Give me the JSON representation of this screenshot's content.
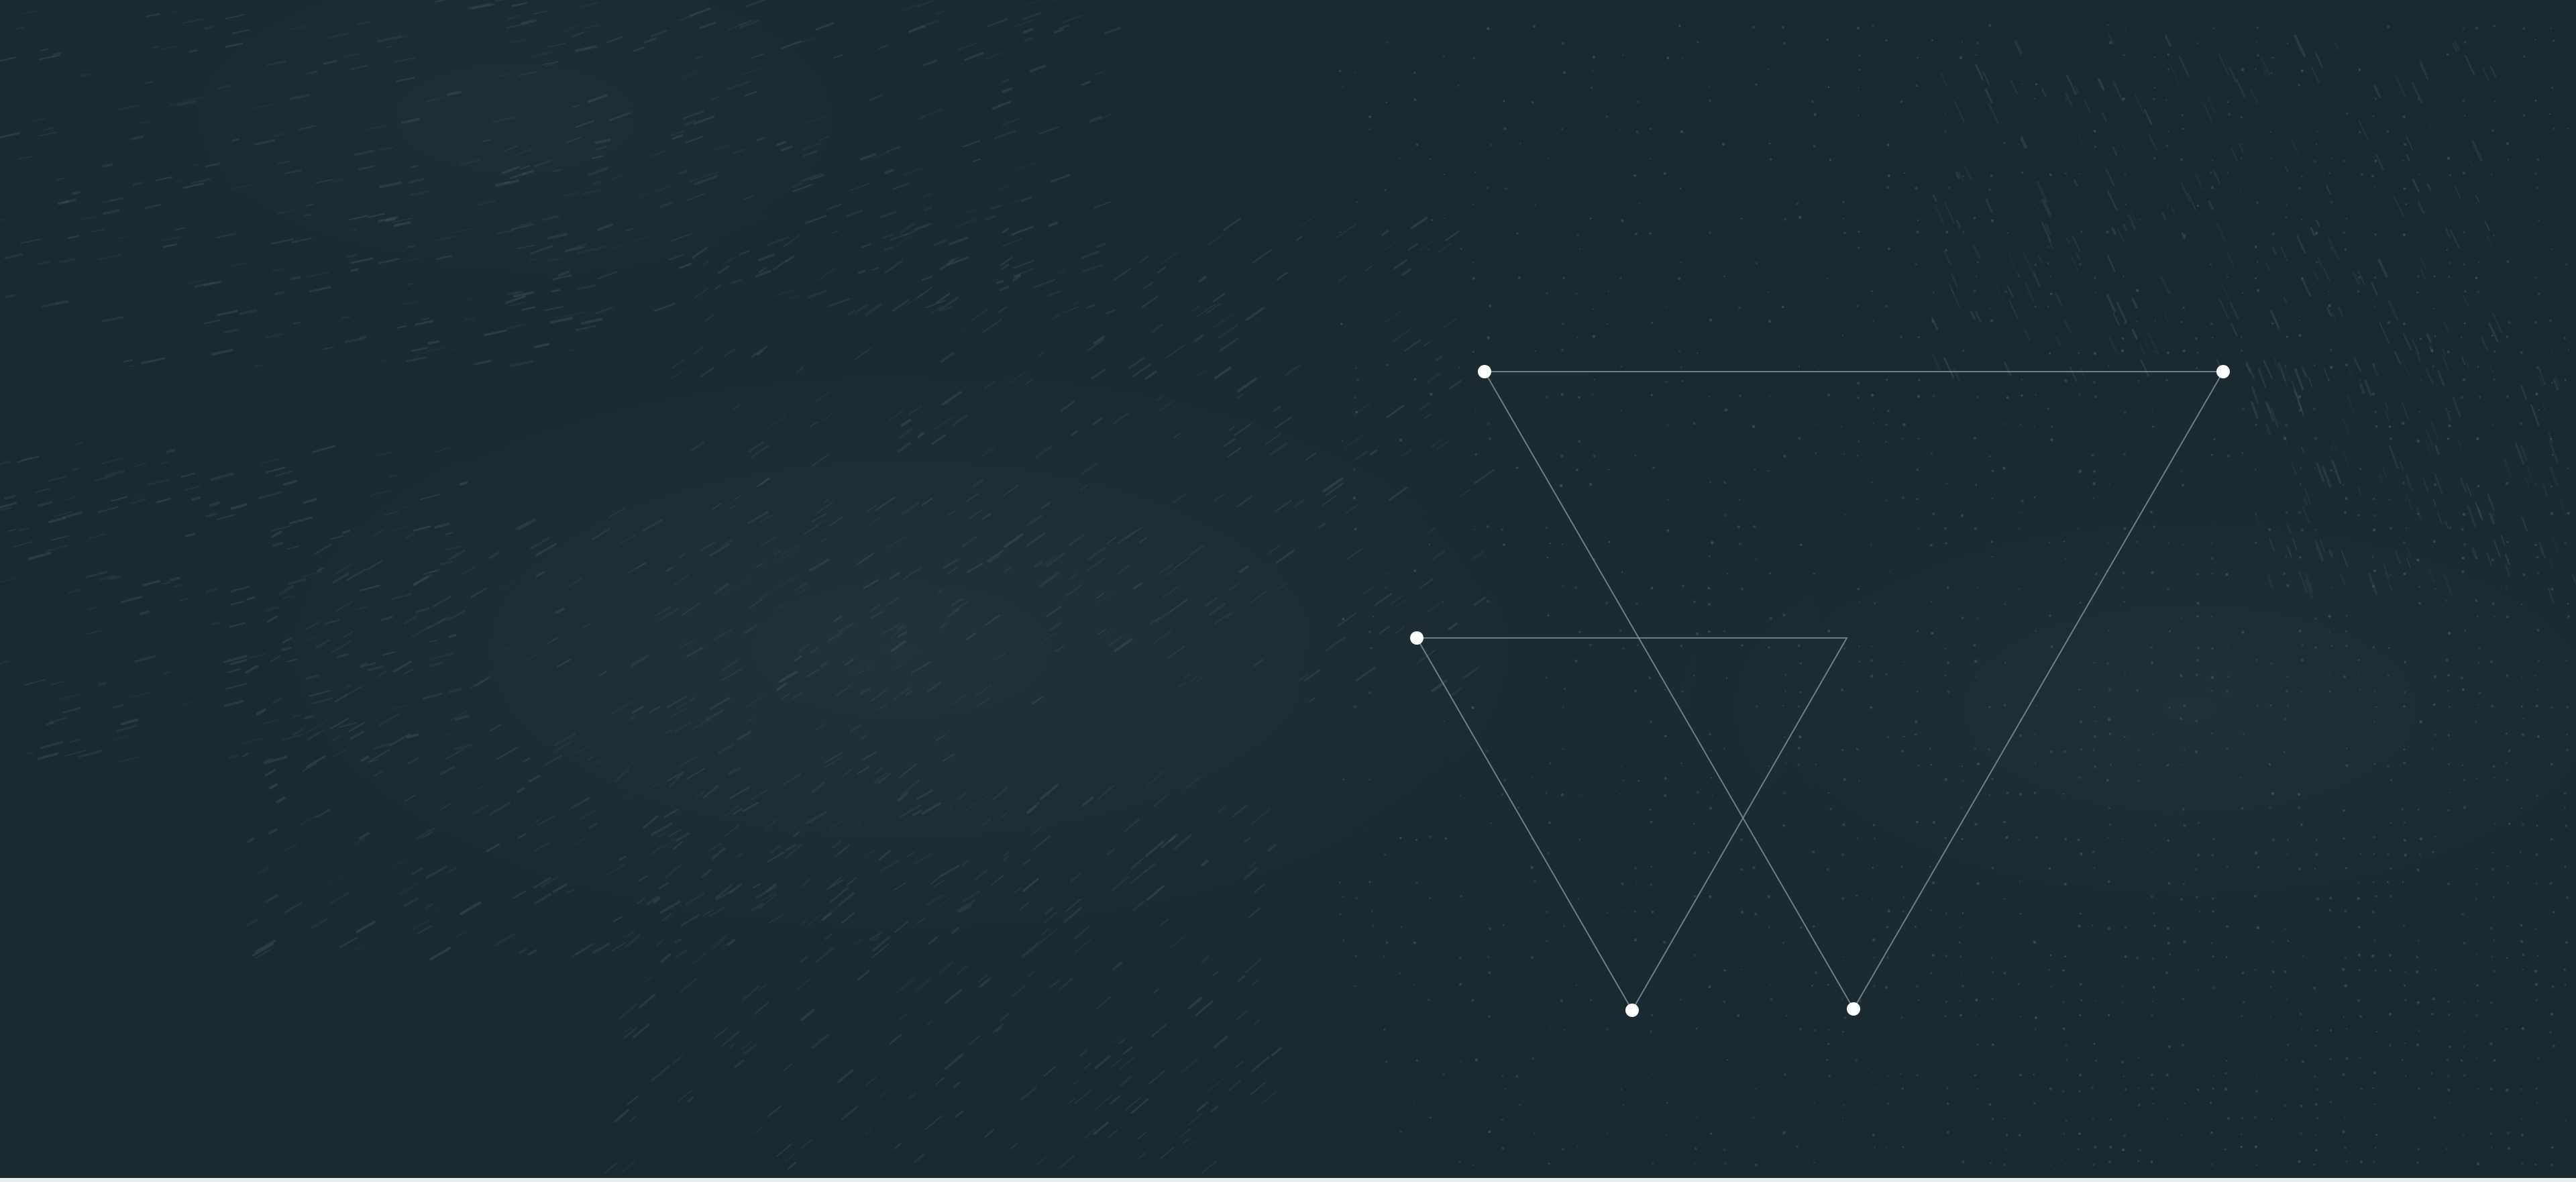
{
  "background": {
    "base_color": "#1b2931",
    "texture_color": "#3a4f59",
    "dot_color": "#4a5f68"
  },
  "graphic": {
    "description_name": "overlapping-inverted-triangles",
    "line_color": "#8a9aa2",
    "node_color": "#ffffff",
    "triangles": [
      {
        "name": "large-inverted-triangle",
        "nodes": 3
      },
      {
        "name": "small-inverted-triangle",
        "nodes": 3
      }
    ]
  }
}
